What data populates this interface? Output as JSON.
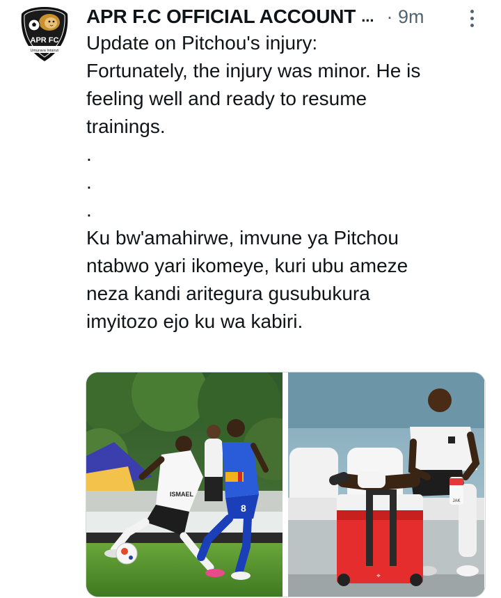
{
  "tweet": {
    "author_name": "APR F.C OFFICIAL ACCOUNT",
    "name_truncation": "...",
    "timestamp": "· 9m",
    "more_icon": "more-vertical-icon",
    "avatar": {
      "icon": "apr-fc-logo",
      "logo_text": "APR FC",
      "motto": "Umurava Intsinzi"
    },
    "text_lines": [
      "Update on Pitchou's injury:",
      "",
      "Fortunately, the injury was minor. He is",
      "feeling well and ready to resume",
      "trainings.",
      ".",
      ".",
      ".",
      "Ku bw'amahirwe, imvune ya Pitchou",
      "ntabwo yari ikomeye, kuri ubu ameze",
      "neza kandi aritegura gusubukura",
      "imyitozo ejo ku wa kabiri."
    ],
    "media": [
      {
        "icon": "football-match-photo",
        "jersey_text": "ISMAEL",
        "jersey_number": "8"
      },
      {
        "icon": "player-resting-photo",
        "bottle_text": "JAK"
      }
    ]
  }
}
